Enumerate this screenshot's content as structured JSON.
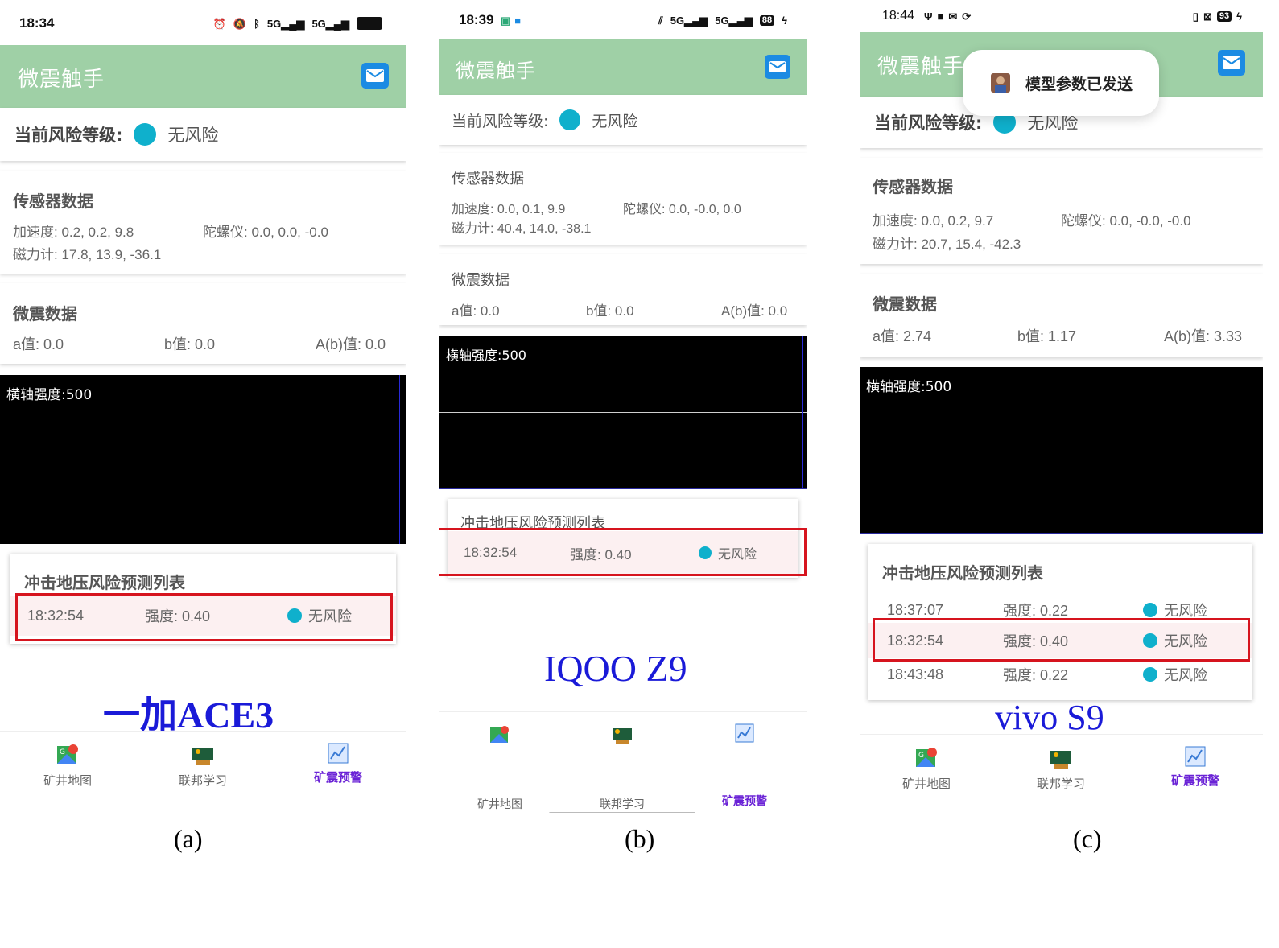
{
  "colors": {
    "app_bar": "#9fd0a6",
    "risk_dot": "#0fb0cc",
    "highlight_box": "#d6141e",
    "device_label": "#1a1ad8",
    "nav_active": "#6a22d6"
  },
  "app": {
    "title": "微震触手",
    "risk_label": "当前风险等级:",
    "sensor_title": "传感器数据",
    "micro_title": "微震数据",
    "chart_label": "横轴强度:500",
    "pred_title": "冲击地压风险预测列表"
  },
  "nav": [
    "矿井地图",
    "联邦学习",
    "矿震预警"
  ],
  "panels": [
    {
      "status_time": "18:34",
      "status_icons": [
        "alarm-icon",
        "mute-icon",
        "bluetooth-icon",
        "5g-signal-icon",
        "5g-signal-icon",
        "battery-icon"
      ],
      "risk_value": "无风险",
      "accel": "加速度: 0.2, 0.2, 9.8",
      "gyro": "陀螺仪: 0.0, 0.0, -0.0",
      "mag": "磁力计: 17.8, 13.9, -36.1",
      "a": "a值: 0.0",
      "b": "b值: 0.0",
      "ab": "A(b)值: 0.0",
      "rows": [
        {
          "time": "18:32:54",
          "strength": "强度: 0.40",
          "risk": "无风险"
        }
      ],
      "device": "一加ACE3",
      "fig": "(a)"
    },
    {
      "status_time": "18:39",
      "status_icons": [
        "app-icon",
        "camera-icon",
        "signal-icon",
        "5g-signal-icon",
        "5g-signal-icon",
        "battery-icon",
        "charging-icon"
      ],
      "battery": "88",
      "risk_value": "无风险",
      "accel": "加速度: 0.0, 0.1, 9.9",
      "gyro": "陀螺仪: 0.0, -0.0, 0.0",
      "mag": "磁力计: 40.4, 14.0, -38.1",
      "a": "a值: 0.0",
      "b": "b值: 0.0",
      "ab": "A(b)值: 0.0",
      "rows": [
        {
          "time": "18:32:54",
          "strength": "强度: 0.40",
          "risk": "无风险"
        }
      ],
      "device": "IQOO Z9",
      "fig": "(b)"
    },
    {
      "status_time": "18:44",
      "status_icons": [
        "usb-icon",
        "video-icon",
        "mail-icon",
        "sync-icon",
        "vibrate-icon",
        "close-box-icon",
        "battery-icon",
        "charging-icon"
      ],
      "battery": "93",
      "risk_value": "无风险",
      "accel": "加速度: 0.0, 0.2, 9.7",
      "gyro": "陀螺仪: 0.0, -0.0, -0.0",
      "mag": "磁力计: 20.7, 15.4, -42.3",
      "a": "a值: 2.74",
      "b": "b值: 1.17",
      "ab": "A(b)值: 3.33",
      "rows": [
        {
          "time": "18:37:07",
          "strength": "强度: 0.22",
          "risk": "无风险"
        },
        {
          "time": "18:32:54",
          "strength": "强度: 0.40",
          "risk": "无风险"
        },
        {
          "time": "18:43:48",
          "strength": "强度: 0.22",
          "risk": "无风险"
        }
      ],
      "toast": "模型参数已发送",
      "device": "vivo S9",
      "fig": "(c)"
    }
  ]
}
